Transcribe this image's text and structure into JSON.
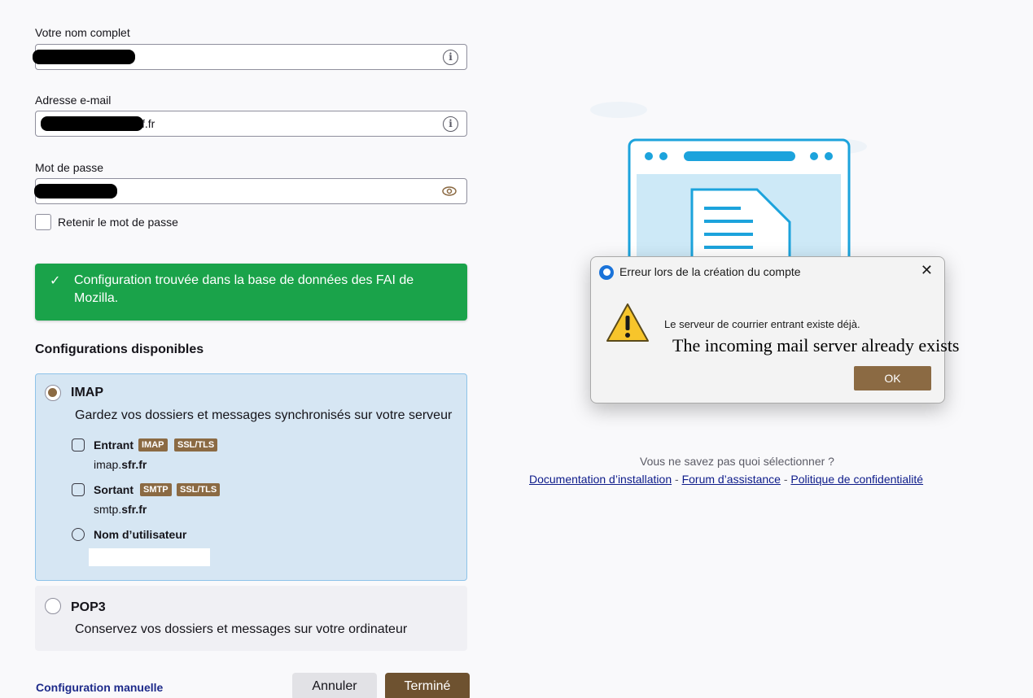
{
  "form": {
    "name_label": "Votre nom complet",
    "email_label": "Adresse e-mail",
    "email_visible_suffix": "f.fr",
    "password_label": "Mot de passe",
    "remember_label": "Retenir le mot de passe"
  },
  "success": {
    "message": "Configuration trouvée dans la base de données des FAI de Mozilla."
  },
  "configs": {
    "title": "Configurations disponibles",
    "imap": {
      "name": "IMAP",
      "description": "Gardez vos dossiers et messages synchronisés sur votre serveur",
      "incoming_label": "Entrant",
      "incoming_badges": [
        "IMAP",
        "SSL/TLS"
      ],
      "incoming_host_prefix": "imap.",
      "incoming_host_domain": "sfr.fr",
      "outgoing_label": "Sortant",
      "outgoing_badges": [
        "SMTP",
        "SSL/TLS"
      ],
      "outgoing_host_prefix": "smtp.",
      "outgoing_host_domain": "sfr.fr",
      "username_label": "Nom d’utilisateur"
    },
    "pop3": {
      "name": "POP3",
      "description": "Conservez vos dossiers et messages sur votre ordinateur"
    }
  },
  "footer": {
    "manual_link": "Configuration manuelle",
    "cancel": "Annuler",
    "done": "Terminé"
  },
  "dialog": {
    "title": "Erreur lors de la création du compte",
    "message": "Le serveur de courrier entrant existe déjà.",
    "translation": "The incoming mail server already exists",
    "ok": "OK"
  },
  "help": {
    "question": "Vous ne savez pas quoi sélectionner ?",
    "links": [
      "Documentation d’installation",
      "Forum d’assistance",
      "Politique de confidentialité"
    ],
    "separator": " - "
  },
  "colors": {
    "success_green": "#1aa34a",
    "accent_brown": "#8b6a43",
    "imap_bg": "#d6e6f3",
    "illustration_blue": "#1ca3dc"
  }
}
